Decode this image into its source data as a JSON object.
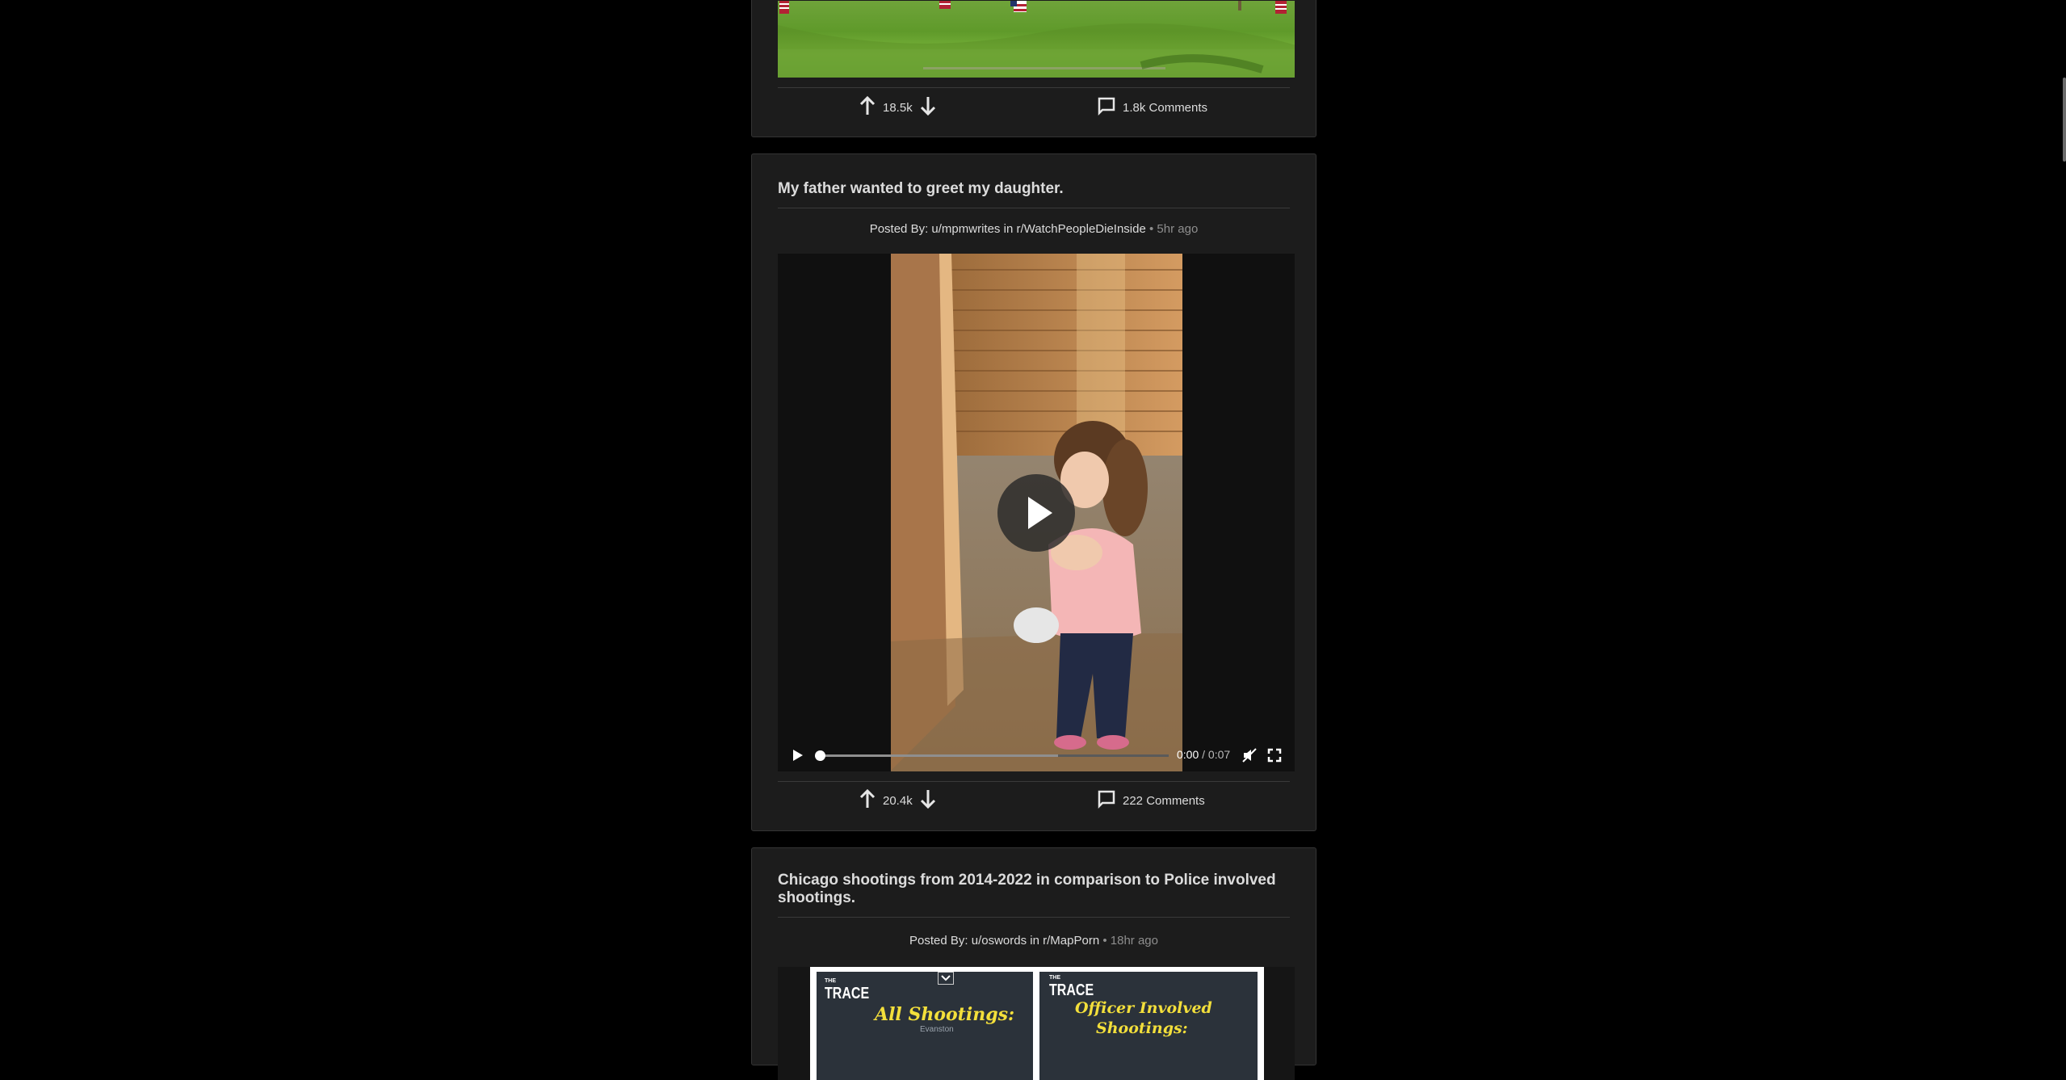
{
  "posts": [
    {
      "title": "",
      "votes": "18.5k",
      "comments": "1.8k Comments"
    },
    {
      "title": "My father wanted to greet my daughter.",
      "posted_by_prefix": "Posted By:",
      "author": "u/mpmwrites",
      "in_word": "in",
      "subreddit": "r/WatchPeopleDieInside",
      "ago": "• 5hr ago",
      "video": {
        "time_current": "0:00",
        "time_separator": "/",
        "time_total": "0:07",
        "progress": 0
      },
      "votes": "20.4k",
      "comments": "222 Comments"
    },
    {
      "title": "Chicago shootings from 2014-2022 in comparison to Police involved shootings.",
      "posted_by_prefix": "Posted By:",
      "author": "u/oswords",
      "in_word": "in",
      "subreddit": "r/MapPorn",
      "ago": "• 18hr ago",
      "image": {
        "left_brand_small": "THE",
        "left_brand": "TRACE",
        "left_heading": "All Shootings:",
        "left_place": "Evanston",
        "right_brand_small": "THE",
        "right_brand": "TRACE",
        "right_heading_line1": "Officer Involved",
        "right_heading_line2": "Shootings:"
      }
    }
  ],
  "colors": {
    "background": "#000000",
    "card": "#1c1c1c",
    "highlight_text": "#f3df3b"
  }
}
